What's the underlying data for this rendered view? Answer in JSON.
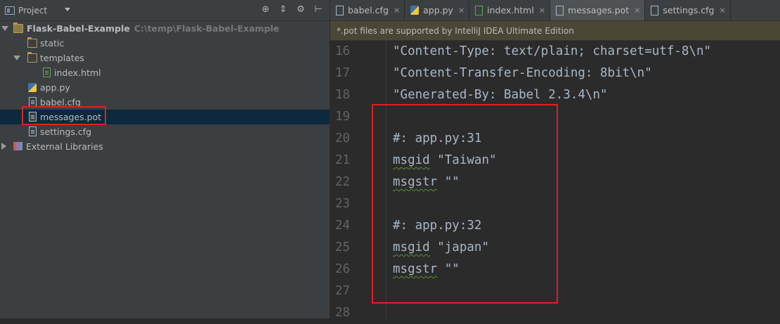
{
  "sidebar": {
    "title": "Project",
    "tree": {
      "root_name": "Flask-Babel-Example",
      "root_path": "C:\\temp\\Flask-Babel-Example",
      "static": "static",
      "templates": "templates",
      "index_html": "index.html",
      "app_py": "app.py",
      "babel_cfg": "babel.cfg",
      "messages_pot": "messages.pot",
      "settings_cfg": "settings.cfg",
      "external_libraries": "External Libraries"
    }
  },
  "editor": {
    "tabs": [
      {
        "label": "babel.cfg",
        "close": "×"
      },
      {
        "label": "app.py",
        "close": "×"
      },
      {
        "label": "index.html",
        "close": "×"
      },
      {
        "label": "messages.pot",
        "close": "×"
      },
      {
        "label": "settings.cfg",
        "close": "×"
      }
    ],
    "notice": "*.pot files are supported by IntelliJ IDEA Ultimate Edition",
    "lines": [
      {
        "num": "16",
        "text": "\"Content-Type: text/plain; charset=utf-8\\n\""
      },
      {
        "num": "17",
        "text": "\"Content-Transfer-Encoding: 8bit\\n\""
      },
      {
        "num": "18",
        "text": "\"Generated-By: Babel 2.3.4\\n\""
      },
      {
        "num": "19",
        "text": ""
      },
      {
        "num": "20",
        "text": "#: app.py:31"
      },
      {
        "num": "21",
        "kw": "msgid",
        "rest": " \"Taiwan\""
      },
      {
        "num": "22",
        "kw": "msgstr",
        "rest": " \"\""
      },
      {
        "num": "23",
        "text": ""
      },
      {
        "num": "24",
        "text": "#: app.py:32"
      },
      {
        "num": "25",
        "kw": "msgid",
        "rest": " \"japan\""
      },
      {
        "num": "26",
        "kw": "msgstr",
        "rest": " \"\""
      },
      {
        "num": "27",
        "text": ""
      },
      {
        "num": "28",
        "text": ""
      }
    ]
  },
  "colors": {
    "highlight": "#e02020",
    "selection": "#0d293e"
  }
}
